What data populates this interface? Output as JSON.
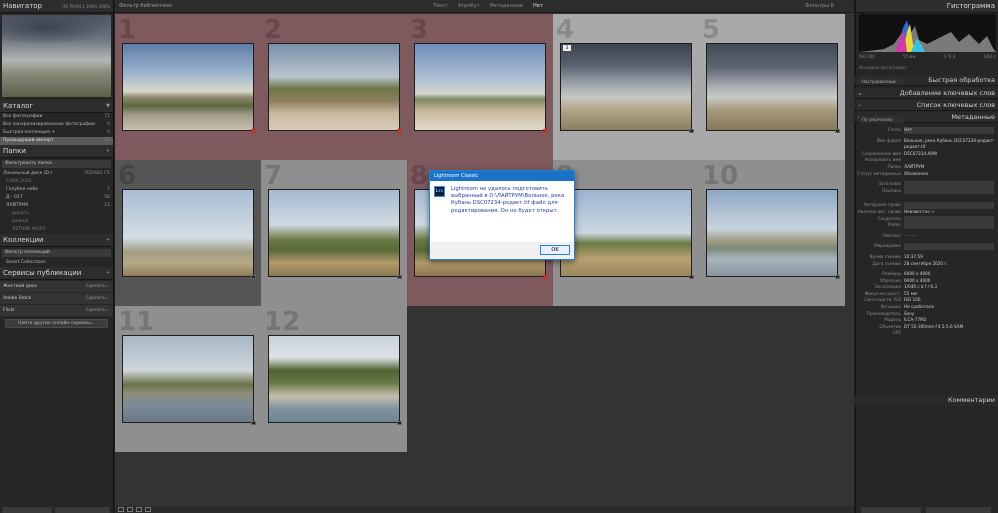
{
  "left": {
    "navigator": {
      "title": "Навигатор",
      "zoom": "ПО РАЗМ   1   100%   400%"
    },
    "catalog": {
      "title": "Каталог",
      "items": [
        {
          "label": "Все фотографии",
          "count": "71"
        },
        {
          "label": "Все синхронизированные фотографии",
          "count": "0"
        },
        {
          "label": "Быстрая коллекция +",
          "count": "0"
        },
        {
          "label": "Предыдущий импорт",
          "count": "12"
        }
      ]
    },
    "folders": {
      "title": "Папки",
      "filter": "Фильтровать папки",
      "drive": {
        "label": "Локальный диск (D:)",
        "size": "762/682 ГБ"
      },
      "items": [
        {
          "label": "CANA 2020",
          "count": ""
        },
        {
          "label": "Голубое небо",
          "count": "1"
        },
        {
          "label": "Д - 027",
          "count": "58"
        },
        {
          "label": "ЛАЙТРУМ",
          "count": "12"
        },
        {
          "label": "дорога",
          "count": ""
        },
        {
          "label": "разное",
          "count": ""
        },
        {
          "label": "ЛЕТНИЕ ФОТО",
          "count": ""
        }
      ]
    },
    "collections": {
      "title": "Коллекции",
      "filter": "Фильтр коллекций",
      "items": [
        {
          "label": "Smart Collections"
        }
      ]
    },
    "publish": {
      "title": "Сервисы публикации",
      "services": [
        {
          "label": "Жесткий диск",
          "action": "Сделать..."
        },
        {
          "label": "Adobe Stock",
          "action": "Сделать..."
        },
        {
          "label": "Flickr",
          "action": "Сделать..."
        }
      ],
      "find_more": "Найти другие онлайн-сервисы..."
    }
  },
  "center": {
    "filter_title": "Фильтр библиотеки:",
    "filter_tabs": [
      "Текст",
      "Атрибут",
      "Метаданные",
      "Нет"
    ],
    "filter_right": "Фильтры В",
    "cells": [
      {
        "num": "1",
        "bg": "red",
        "thumb": "sky1",
        "flag": ""
      },
      {
        "num": "2",
        "bg": "red",
        "thumb": "sky2",
        "flag": ""
      },
      {
        "num": "3",
        "bg": "red",
        "thumb": "sky3",
        "flag": ""
      },
      {
        "num": "4",
        "bg": "lgray",
        "thumb": "sky4",
        "flag": "3"
      },
      {
        "num": "5",
        "bg": "lgray",
        "thumb": "sky5",
        "flag": ""
      },
      {
        "num": "6",
        "bg": "dgray",
        "thumb": "sky6",
        "flag": ""
      },
      {
        "num": "7",
        "bg": "mgray",
        "thumb": "sky7",
        "flag": ""
      },
      {
        "num": "8",
        "bg": "red",
        "thumb": "sky7",
        "flag": ""
      },
      {
        "num": "9",
        "bg": "mgray",
        "thumb": "sky9",
        "flag": ""
      },
      {
        "num": "10",
        "bg": "mgray",
        "thumb": "sky10",
        "flag": ""
      },
      {
        "num": "11",
        "bg": "mgray",
        "thumb": "sky11",
        "flag": ""
      },
      {
        "num": "12",
        "bg": "mgray",
        "thumb": "sky12",
        "flag": ""
      }
    ],
    "dialog": {
      "title": "Lightroom Classic",
      "icon": "Lrc",
      "message": "Lightroom не удалось подготовить выбранный в D:\\ЛАЙТРУМ\\Вольное, река Кубань DSC07234-редакт.tif файл для редактирования. Он не будет открыт.",
      "ok": "OK"
    }
  },
  "right": {
    "histogram": {
      "title": "Гистограмма",
      "info_left": "ISO 100",
      "info_mid": "55 мм",
      "info_right": "f / 6,3",
      "info_last": "1/60 с",
      "orig": "Исходная фотография"
    },
    "quick_develop": {
      "title": "Быстрая обработка",
      "preset": "Настраиваемый"
    },
    "keywording": {
      "title": "Добавление ключевых слов"
    },
    "keyword_list": {
      "title": "Список ключевых слов"
    },
    "metadata": {
      "title": "Метаданные",
      "preset": "По умолчанию",
      "rows": [
        {
          "k": "Стиль",
          "v": "Нет",
          "box": true
        },
        {
          "k": "",
          "v": ""
        },
        {
          "k": "Имя файла",
          "v": "Вольное, река Кубань DSC07234-редакт-",
          "box": false
        },
        {
          "k": "",
          "v": "редакт.tif",
          "box": false
        },
        {
          "k": "Сохраненное имя",
          "v": "DSC07234.ARW",
          "box": false
        },
        {
          "k": "Копировать имя",
          "v": "",
          "box": false
        },
        {
          "k": "Папка",
          "v": "ЛАЙТРУМ",
          "box": false
        },
        {
          "k": "Статус метаданных",
          "v": "Обновлено",
          "box": false
        },
        {
          "k": "",
          "v": ""
        },
        {
          "k": "Заголовок",
          "v": "",
          "box": true
        },
        {
          "k": "Подпись",
          "v": "",
          "box": true
        },
        {
          "k": "",
          "v": ""
        },
        {
          "k": "",
          "v": ""
        },
        {
          "k": "Авторское право",
          "v": "",
          "box": true
        },
        {
          "k": "Наличие авт. права",
          "v": "Неизвестно ÷",
          "box": false
        },
        {
          "k": "Создатель",
          "v": "",
          "box": true
        },
        {
          "k": "Район",
          "v": "",
          "box": true
        },
        {
          "k": "",
          "v": ""
        },
        {
          "k": "Рейтинг",
          "v": "·  ·  ·  ·  ·",
          "box": false
        },
        {
          "k": "",
          "v": ""
        },
        {
          "k": "Маркировка",
          "v": "",
          "box": true
        },
        {
          "k": "",
          "v": ""
        },
        {
          "k": "Время съемки",
          "v": "10:37:59",
          "box": false
        },
        {
          "k": "Дата съемки",
          "v": "28 сентября 2020 г.",
          "box": false
        },
        {
          "k": "",
          "v": ""
        },
        {
          "k": "Размеры",
          "v": "6000 x 4000",
          "box": false
        },
        {
          "k": "Обрезано",
          "v": "6000 x 4000",
          "box": false
        },
        {
          "k": "Экспозиция",
          "v": "1/640 с в f / 6,3",
          "box": false
        },
        {
          "k": "Фокусное расст.",
          "v": "55 мм",
          "box": false
        },
        {
          "k": "Светочувств. ISO",
          "v": "ISO 100",
          "box": false
        },
        {
          "k": "Вспышка",
          "v": "Не сработала",
          "box": false
        },
        {
          "k": "Производитель",
          "v": "Sony",
          "box": false
        },
        {
          "k": "Модель",
          "v": "ILCA-77M2",
          "box": false
        },
        {
          "k": "Объектив",
          "v": "DT 55-300mm F4.5-5.6 SAM",
          "box": false
        },
        {
          "k": "GPS",
          "v": "",
          "box": false
        }
      ]
    },
    "comments": {
      "title": "Комментарии"
    }
  }
}
